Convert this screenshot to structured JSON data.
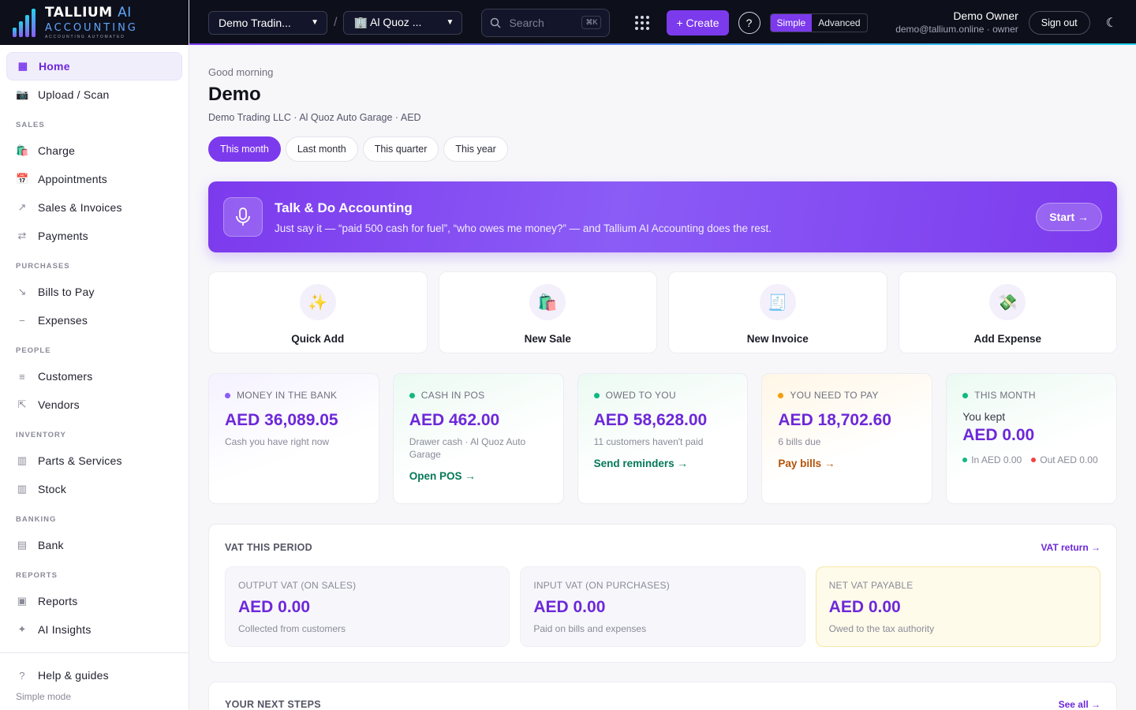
{
  "brand": {
    "name": "TALLIUM",
    "ai": "AI",
    "line2": "ACCOUNTING",
    "tagline": "ACCOUNTING AUTOMATED"
  },
  "topbar": {
    "company": "Demo Tradin...",
    "separator": "/",
    "branch": "🏢 Al Quoz ...",
    "search_placeholder": "Search",
    "search_shortcut": "⌘K",
    "create_label": "+ Create",
    "help_label": "?",
    "mode_simple": "Simple",
    "mode_advanced": "Advanced",
    "user_name": "Demo Owner",
    "user_meta": "demo@tallium.online · owner",
    "signout_label": "Sign out",
    "theme_icon": "☾"
  },
  "sidebar": {
    "home": {
      "icon": "▦",
      "label": "Home"
    },
    "upload": {
      "icon": "📷",
      "label": "Upload / Scan"
    },
    "sections": {
      "sales": "SALES",
      "purchases": "PURCHASES",
      "people": "PEOPLE",
      "inventory": "INVENTORY",
      "banking": "BANKING",
      "reports": "REPORTS"
    },
    "items": {
      "charge": {
        "icon": "🛍️",
        "label": "Charge"
      },
      "appointments": {
        "icon": "📅",
        "label": "Appointments"
      },
      "sales_invoices": {
        "icon": "↗",
        "label": "Sales & Invoices"
      },
      "payments": {
        "icon": "⇄",
        "label": "Payments"
      },
      "bills": {
        "icon": "↘",
        "label": "Bills to Pay"
      },
      "expenses": {
        "icon": "−",
        "label": "Expenses"
      },
      "customers": {
        "icon": "≡",
        "label": "Customers"
      },
      "vendors": {
        "icon": "⇱",
        "label": "Vendors"
      },
      "parts": {
        "icon": "▥",
        "label": "Parts & Services"
      },
      "stock": {
        "icon": "▥",
        "label": "Stock"
      },
      "bank": {
        "icon": "▤",
        "label": "Bank"
      },
      "reports": {
        "icon": "▣",
        "label": "Reports"
      },
      "insights": {
        "icon": "✦",
        "label": "AI Insights"
      }
    },
    "help": {
      "icon": "?",
      "label": "Help & guides"
    },
    "mode_text": "Simple mode"
  },
  "main": {
    "greeting": "Good morning",
    "name": "Demo",
    "org_line": "Demo Trading LLC · Al Quoz Auto Garage · AED",
    "periods": [
      "This month",
      "Last month",
      "This quarter",
      "This year"
    ],
    "active_period": "This month",
    "banner": {
      "title": "Talk & Do Accounting",
      "subtitle": "Just say it — “paid 500 cash for fuel”, “who owes me money?” — and Tallium AI Accounting does the rest.",
      "cta": "Start →"
    },
    "quick_actions": [
      {
        "icon": "✨",
        "label": "Quick Add"
      },
      {
        "icon": "🛍️",
        "label": "New Sale"
      },
      {
        "icon": "🧾",
        "label": "New Invoice"
      },
      {
        "icon": "💸",
        "label": "Add Expense"
      }
    ],
    "stats": {
      "bank": {
        "label": "MONEY IN THE BANK",
        "value": "AED 36,089.05",
        "sub": "Cash you have right now",
        "dot": "#8b5cf6"
      },
      "pos": {
        "label": "CASH IN POS",
        "value": "AED 462.00",
        "sub": "Drawer cash · Al Quoz Auto Garage",
        "link": "Open POS →",
        "dot": "#10b981"
      },
      "owed": {
        "label": "OWED TO YOU",
        "value": "AED 58,628.00",
        "sub": "11 customers haven't paid",
        "link": "Send reminders →",
        "dot": "#10b981"
      },
      "pay": {
        "label": "YOU NEED TO PAY",
        "value": "AED 18,702.60",
        "sub": "6 bills due",
        "link": "Pay bills →",
        "dot": "#f59e0b"
      },
      "month": {
        "label": "THIS MONTH",
        "kept_label": "You kept",
        "value": "AED 0.00",
        "in": "In AED 0.00",
        "out": "Out AED 0.00",
        "dot": "#10b981"
      }
    },
    "vat": {
      "title": "VAT THIS PERIOD",
      "link": "VAT return →",
      "output": {
        "label": "OUTPUT VAT (ON SALES)",
        "value": "AED 0.00",
        "sub": "Collected from customers"
      },
      "input": {
        "label": "INPUT VAT (ON PURCHASES)",
        "value": "AED 0.00",
        "sub": "Paid on bills and expenses"
      },
      "net": {
        "label": "NET VAT PAYABLE",
        "value": "AED 0.00",
        "sub": "Owed to the tax authority"
      }
    },
    "next_steps": {
      "title": "YOUR NEXT STEPS",
      "link": "See all →"
    }
  },
  "colors": {
    "accent": "#7c3aed",
    "green_link": "#047857",
    "amber_link": "#b45309",
    "in_dot": "#10b981",
    "out_dot": "#ef4444"
  }
}
